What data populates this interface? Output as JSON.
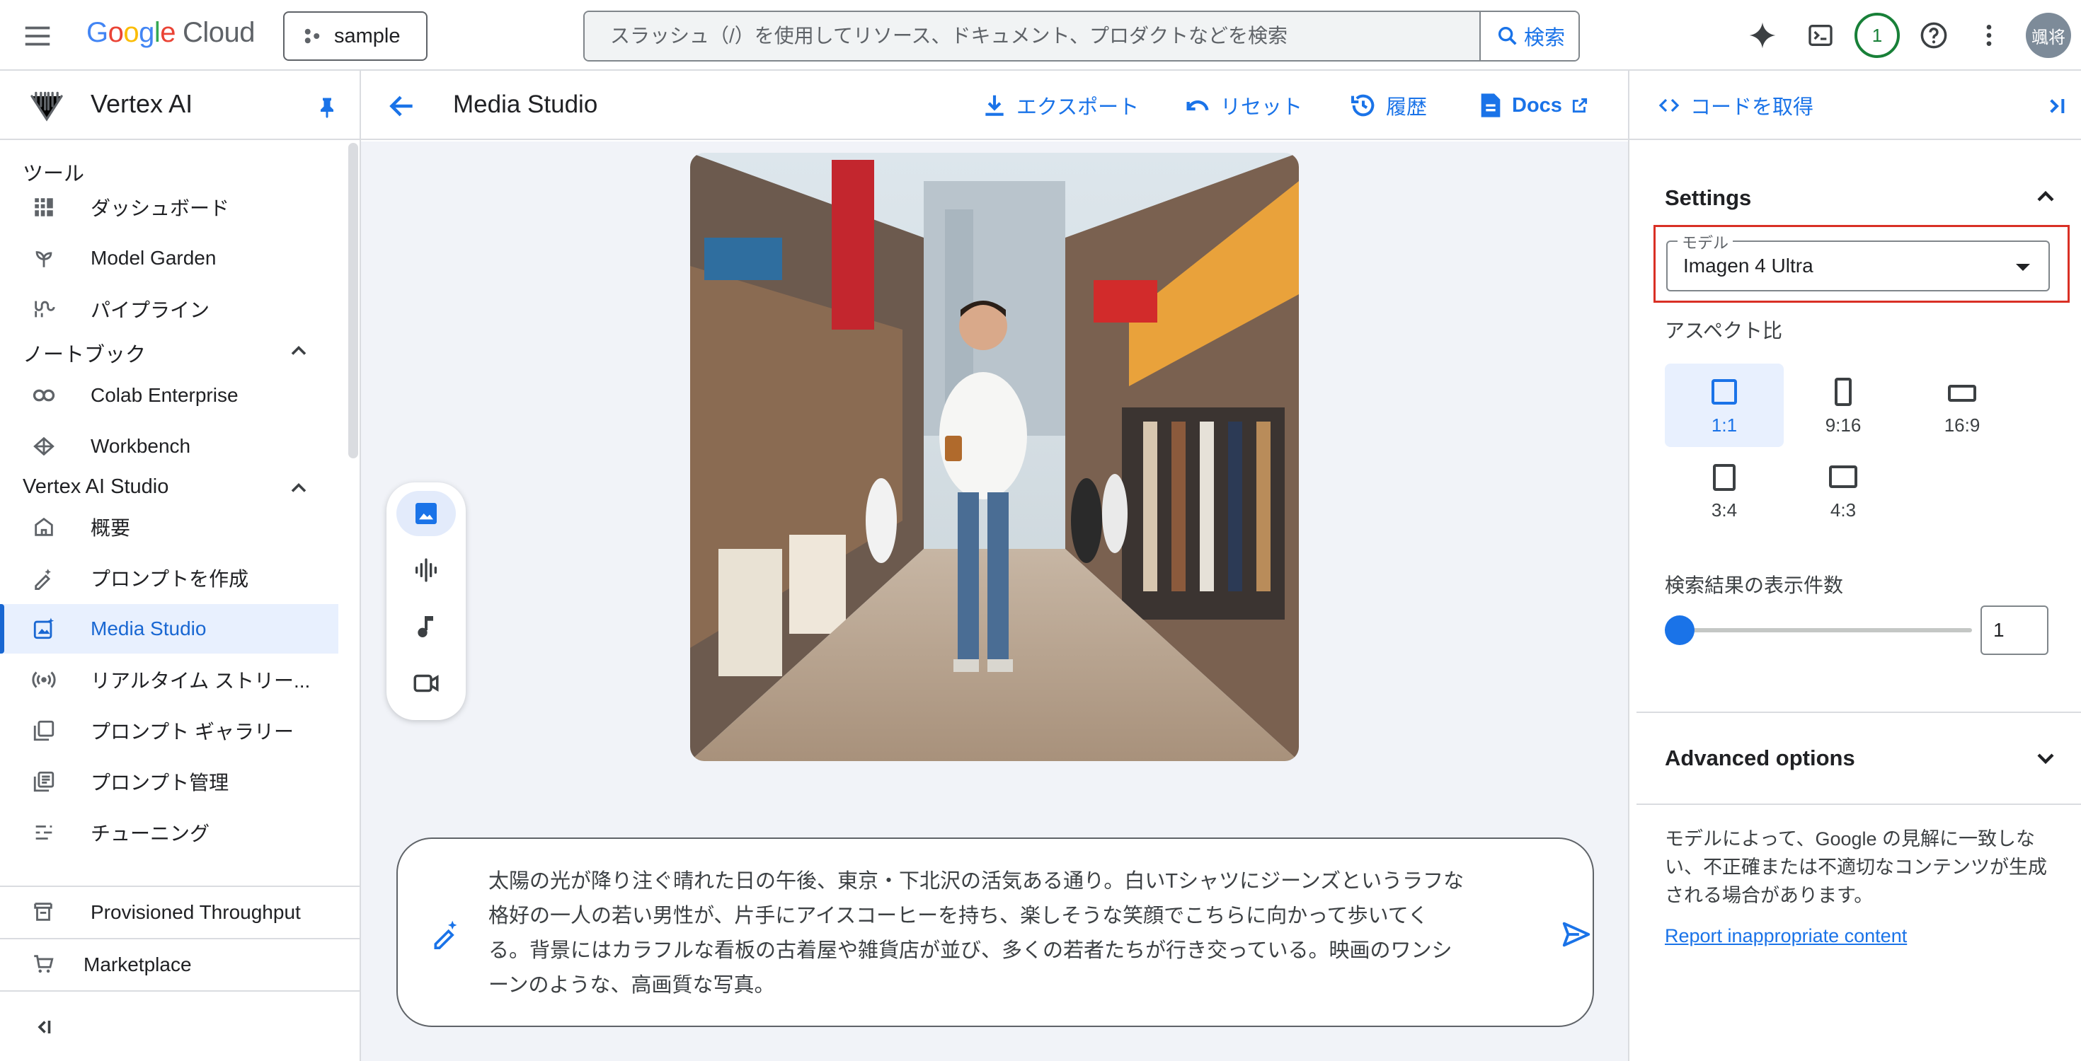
{
  "topbar": {
    "logo_google": "Google",
    "logo_cloud": "Cloud",
    "project": "sample",
    "search_placeholder": "スラッシュ（/）を使用してリソース、ドキュメント、プロダクトなどを検索",
    "search_button": "検索",
    "notification_count": "1",
    "avatar_initials": "颯将"
  },
  "sidebar": {
    "product_title": "Vertex AI",
    "sections": [
      {
        "label": "ツール",
        "collapsible": false,
        "items": [
          {
            "label": "ダッシュボード",
            "icon": "dashboard-icon"
          },
          {
            "label": "Model Garden",
            "icon": "model-garden-icon"
          },
          {
            "label": "パイプライン",
            "icon": "pipeline-icon"
          }
        ]
      },
      {
        "label": "ノートブック",
        "collapsible": true,
        "items": [
          {
            "label": "Colab Enterprise",
            "icon": "colab-icon"
          },
          {
            "label": "Workbench",
            "icon": "workbench-icon"
          }
        ]
      },
      {
        "label": "Vertex AI Studio",
        "collapsible": true,
        "items": [
          {
            "label": "概要",
            "icon": "home-icon"
          },
          {
            "label": "プロンプトを作成",
            "icon": "create-prompt-icon"
          },
          {
            "label": "Media Studio",
            "icon": "media-studio-icon",
            "active": true
          },
          {
            "label": "リアルタイム ストリー...",
            "icon": "streaming-icon"
          },
          {
            "label": "プロンプト ギャラリー",
            "icon": "gallery-icon"
          },
          {
            "label": "プロンプト管理",
            "icon": "prompt-manage-icon"
          },
          {
            "label": "チューニング",
            "icon": "tuning-icon"
          }
        ]
      }
    ],
    "bottom_items": [
      {
        "label": "Provisioned Throughput",
        "icon": "throughput-icon"
      },
      {
        "label": "Marketplace",
        "icon": "marketplace-icon"
      }
    ]
  },
  "main_header": {
    "title": "Media Studio",
    "actions": {
      "export": "エクスポート",
      "reset": "リセット",
      "history": "履歴",
      "docs": "Docs"
    }
  },
  "main": {
    "image_alt": "Generated image: young man in white T-shirt walking down a Shimokitazawa street holding iced coffee",
    "tool_rail": [
      "image-icon",
      "audio-waveform-icon",
      "music-note-icon",
      "video-icon"
    ],
    "prompt": "太陽の光が降り注ぐ晴れた日の午後、東京・下北沢の活気ある通り。白いTシャツにジーンズというラフな格好の一人の若い男性が、片手にアイスコーヒーを持ち、楽しそうな笑顔でこちらに向かって歩いてくる。背景にはカラフルな看板の古着屋や雑貨店が並び、多くの若者たちが行き交っている。映画のワンシーンのような、高画質な写真。"
  },
  "right_panel": {
    "get_code": "コードを取得",
    "settings_title": "Settings",
    "model_label": "モデル",
    "model_value": "Imagen 4 Ultra",
    "aspect_label": "アスペクト比",
    "aspect_ratios": [
      {
        "label": "1:1",
        "selected": true
      },
      {
        "label": "9:16",
        "selected": false
      },
      {
        "label": "16:9",
        "selected": false
      },
      {
        "label": "3:4",
        "selected": false
      },
      {
        "label": "4:3",
        "selected": false
      }
    ],
    "result_count_label": "検索結果の表示件数",
    "result_count_value": "1",
    "advanced_title": "Advanced options",
    "disclaimer": "モデルによって、Google の見解に一致しない、不正確または不適切なコンテンツが生成される場合があります。",
    "report_link": "Report inappropriate content"
  },
  "colors": {
    "accent": "#1a73e8",
    "active_bg": "#e8f0fe",
    "highlight_border": "#d93025",
    "main_bg": "#f1f3f8"
  }
}
